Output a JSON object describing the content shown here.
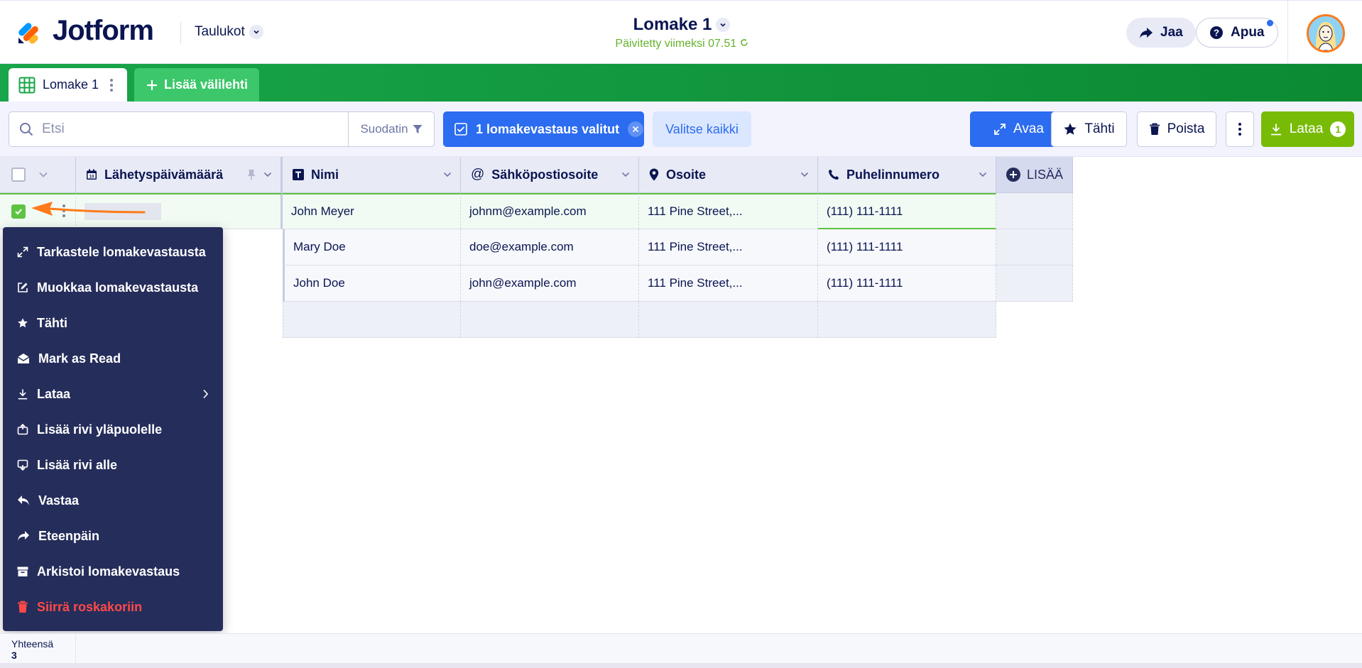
{
  "header": {
    "logo_text": "Jotform",
    "tables_menu": "Taulukot",
    "form_title": "Lomake 1",
    "updated_text": "Päivitetty viimeksi 07.51",
    "share_label": "Jaa",
    "help_label": "Apua"
  },
  "tabs": {
    "active_label": "Lomake 1",
    "add_tab_label": "Lisää välilehti"
  },
  "toolbar": {
    "search_placeholder": "Etsi",
    "filter_label": "Suodatin",
    "selected_label": "1 lomakevastaus valitut",
    "select_all_label": "Valitse kaikki",
    "open_label": "Avaa",
    "star_label": "Tähti",
    "delete_label": "Poista",
    "download_label": "Lataa",
    "download_badge": "1"
  },
  "columns": {
    "date": "Lähetyspäivämäärä",
    "name": "Nimi",
    "email": "Sähköpostiosoite",
    "address": "Osoite",
    "phone": "Puhelinnumero",
    "add": "LISÄÄ"
  },
  "rows": [
    {
      "name": "John Meyer",
      "email": "johnm@example.com",
      "address": "111 Pine Street,...",
      "phone": "(111) 111-1111",
      "selected": true
    },
    {
      "name": "Mary Doe",
      "email": "doe@example.com",
      "address": "111 Pine Street,...",
      "phone": "(111) 111-1111",
      "selected": false
    },
    {
      "name": "John Doe",
      "email": "john@example.com",
      "address": "111 Pine Street,...",
      "phone": "(111) 111-1111",
      "selected": false
    }
  ],
  "context_menu": {
    "items": [
      {
        "label": "Tarkastele lomakevastausta",
        "icon": "expand-icon"
      },
      {
        "label": "Muokkaa lomakevastausta",
        "icon": "edit-icon"
      },
      {
        "label": "Tähti",
        "icon": "star-icon"
      },
      {
        "label": "Mark as Read",
        "icon": "envelope-open-icon"
      },
      {
        "label": "Lataa",
        "icon": "download-icon"
      },
      {
        "label": "Lisää rivi yläpuolelle",
        "icon": "insert-above-icon"
      },
      {
        "label": "Lisää rivi alle",
        "icon": "insert-below-icon"
      },
      {
        "label": "Vastaa",
        "icon": "reply-icon"
      },
      {
        "label": "Eteenpäin",
        "icon": "forward-icon"
      },
      {
        "label": "Arkistoi lomakevastaus",
        "icon": "archive-icon"
      },
      {
        "label": "Siirrä roskakoriin",
        "icon": "trash-icon"
      }
    ]
  },
  "footer": {
    "total_label": "Yhteensä",
    "total_value": "3"
  },
  "colors": {
    "brand_green": "#0b8a32",
    "primary_blue": "#2b6cf0",
    "download_green": "#78bb07",
    "menu_bg": "#252d5b",
    "danger": "#ff4948",
    "arrow": "#ff7a1a"
  }
}
